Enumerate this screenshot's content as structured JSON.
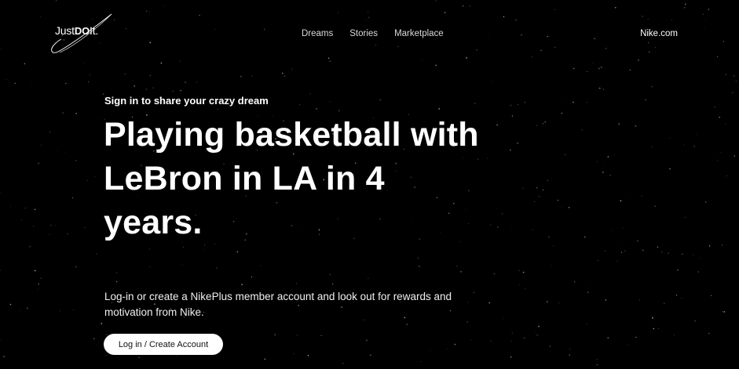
{
  "header": {
    "logo": {
      "text_parts": [
        "Just",
        "DO",
        "It."
      ],
      "icon": "swoosh-icon"
    },
    "nav": [
      {
        "label": "Dreams"
      },
      {
        "label": "Stories"
      },
      {
        "label": "Marketplace"
      }
    ],
    "external_link": "Nike.com"
  },
  "hero": {
    "subtitle": "Sign in to share your crazy dream",
    "headline": "Playing basketball with LeBron in LA in 4 years.",
    "description": "Log-in or create a NikePlus member account and look out for rewards and motivation from Nike.",
    "cta_label": "Log in / Create Account"
  },
  "colors": {
    "background": "#000000",
    "text": "#ffffff",
    "nav_text": "#d9d9d9",
    "button_background": "#ffffff",
    "button_text": "#111111"
  }
}
